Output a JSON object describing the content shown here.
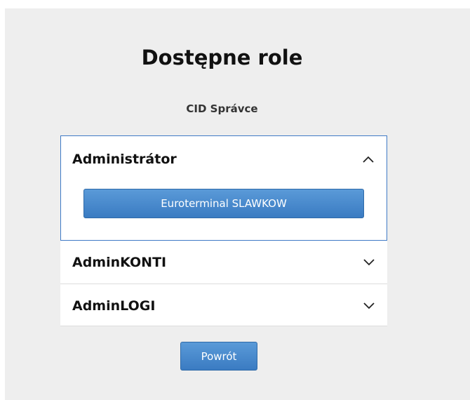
{
  "page": {
    "title": "Dostępne role",
    "subtitle": "CID Správce"
  },
  "accordion": {
    "items": [
      {
        "label": "Administrátor",
        "expanded": true,
        "icon": "chevron-up-icon",
        "roles": [
          "Euroterminal SLAWKOW"
        ]
      },
      {
        "label": "AdminKONTI",
        "expanded": false,
        "icon": "chevron-down-icon"
      },
      {
        "label": "AdminLOGI",
        "expanded": false,
        "icon": "chevron-down-icon"
      }
    ]
  },
  "actions": {
    "back_label": "Powrót"
  },
  "colors": {
    "background": "#eeeeee",
    "accent": "#3a7bc2",
    "open_border": "#3f7ac6"
  }
}
